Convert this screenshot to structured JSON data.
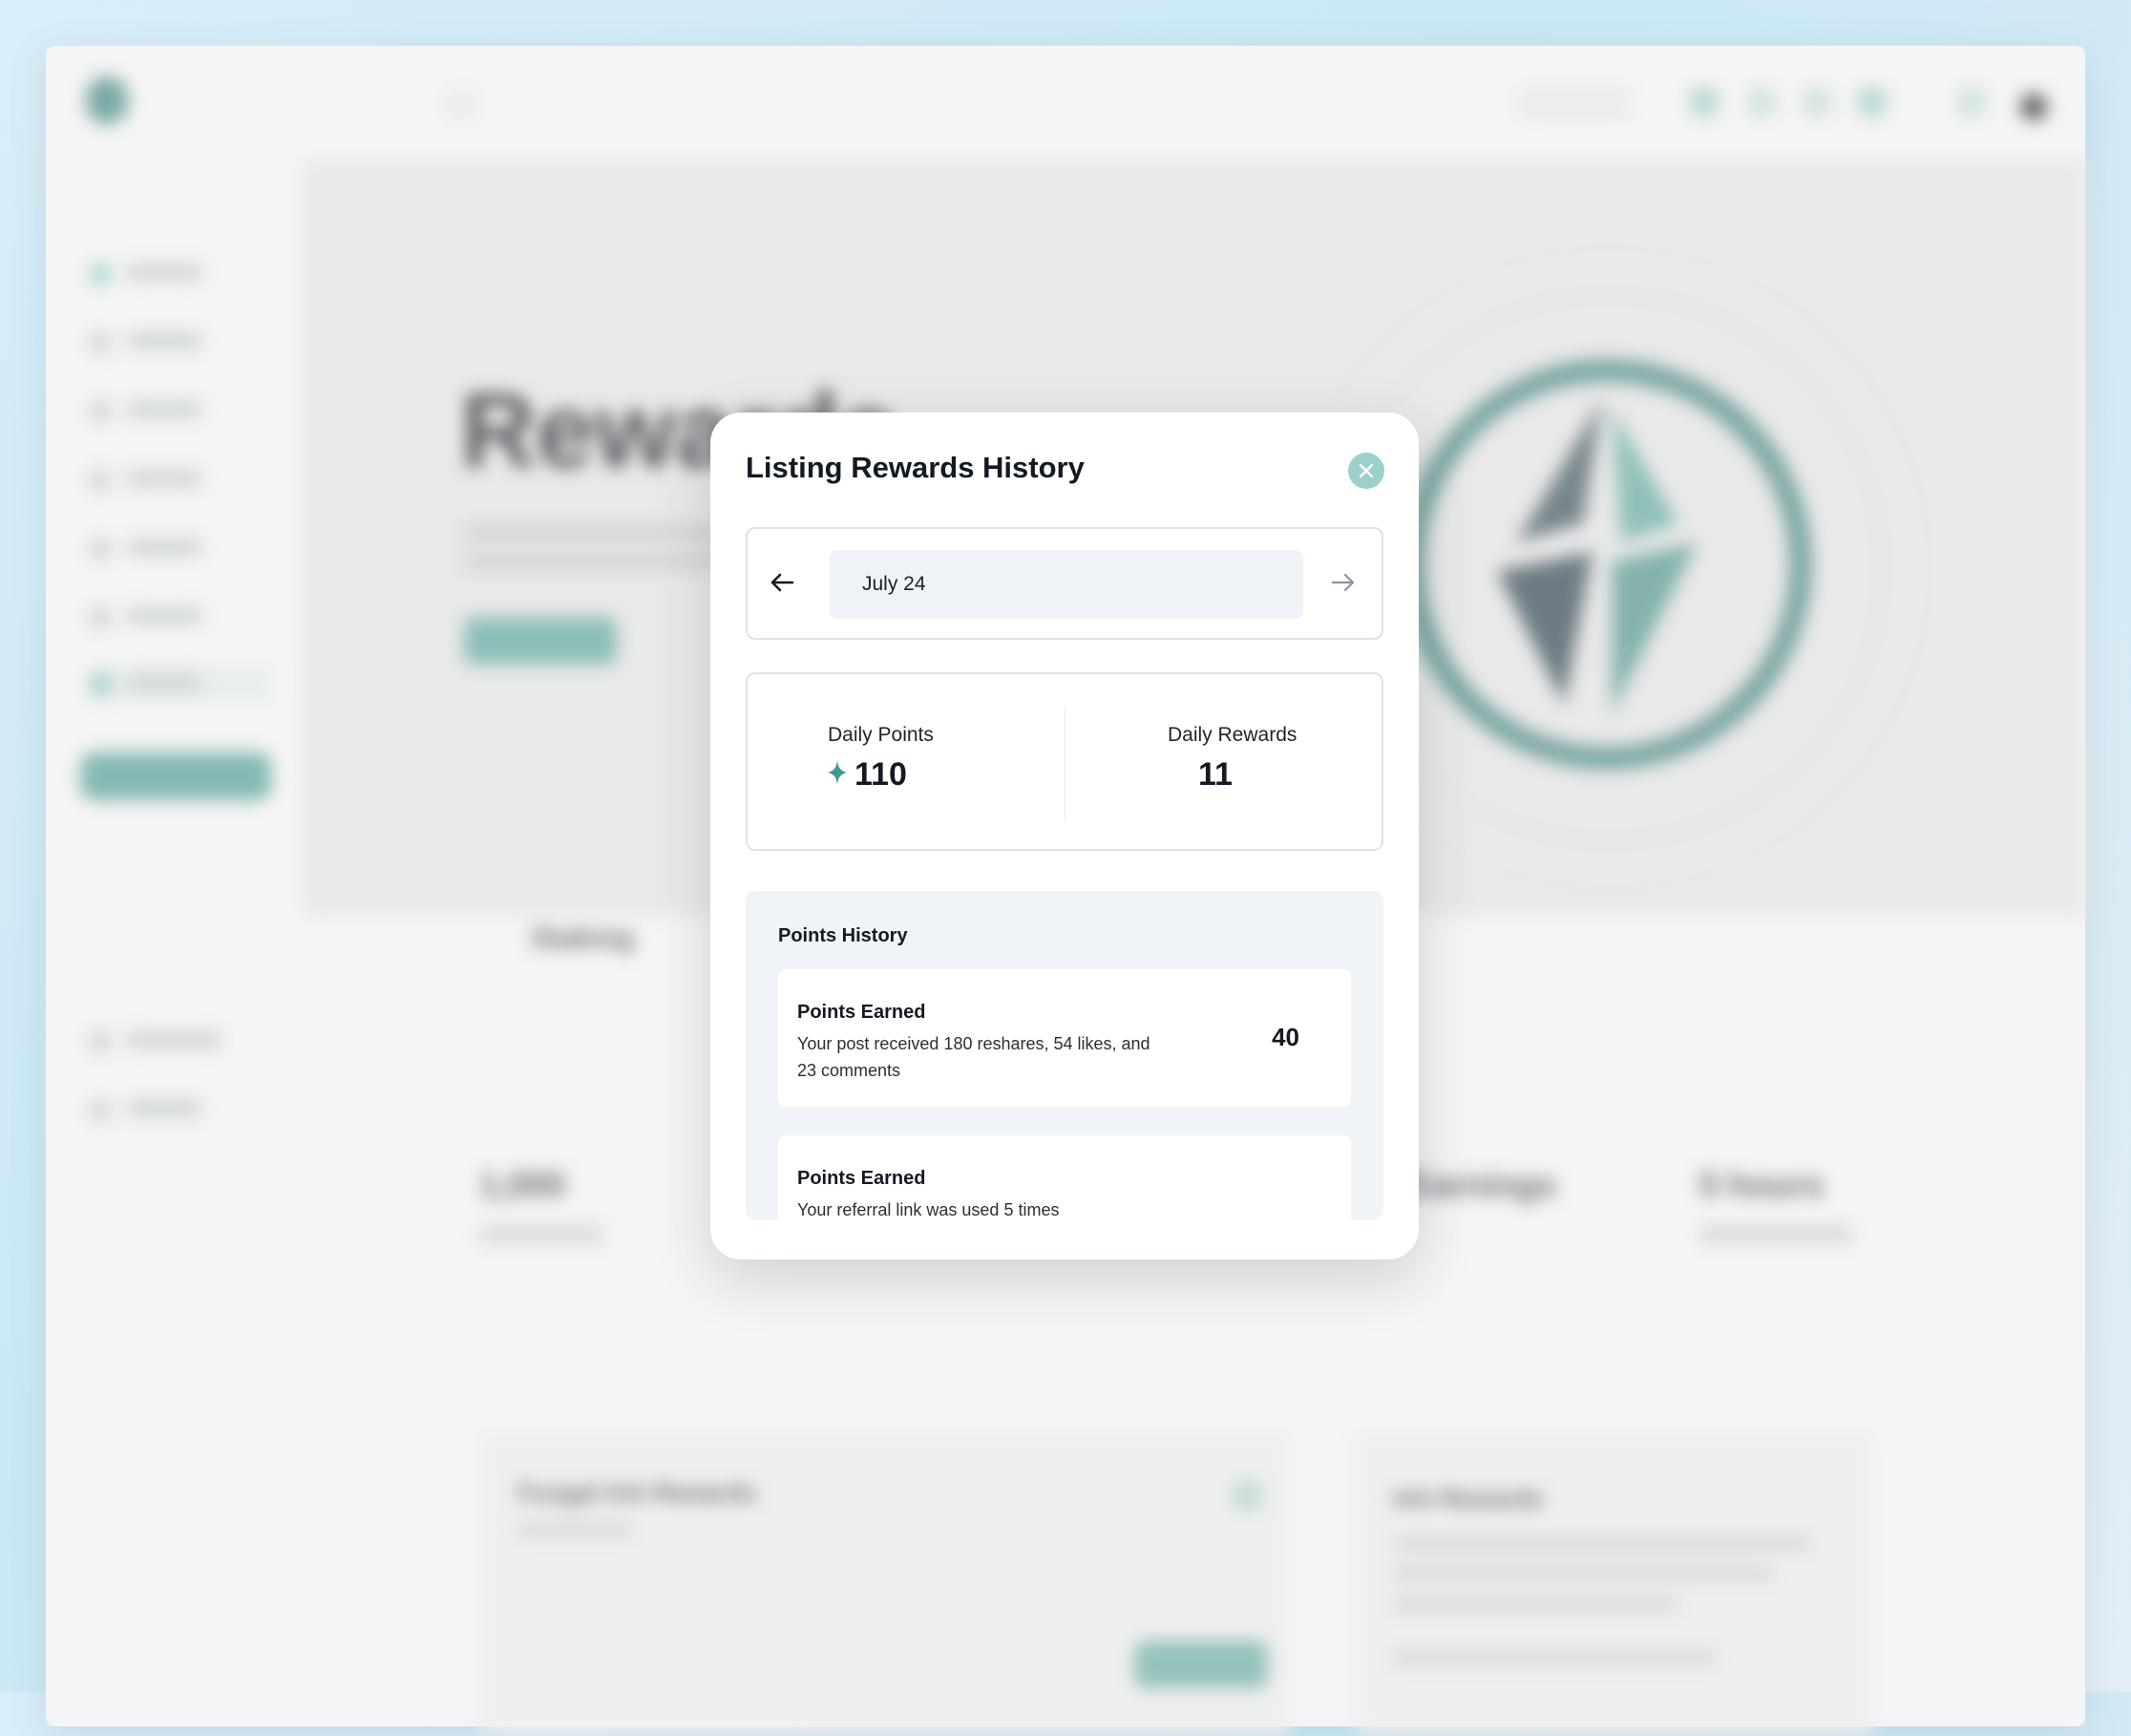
{
  "background": {
    "hero_title": "Rewards",
    "section_label": "Staking",
    "stat_1": "1,000",
    "stat_2": "Earnings",
    "stat_3": "5 hours",
    "card_title": "Fungal Ark Rewards",
    "card_right_title": "Ark Rewards"
  },
  "modal": {
    "title": "Listing Rewards History",
    "date": "July 24",
    "daily_points_label": "Daily Points",
    "daily_points_value": "110",
    "daily_rewards_label": "Daily Rewards",
    "daily_rewards_value": "11",
    "history_title": "Points History",
    "history": [
      {
        "title": "Points Earned",
        "description": "Your post received 180 reshares, 54 likes, and 23 comments",
        "points": "40"
      },
      {
        "title": "Points Earned",
        "description": "Your referral link was used 5 times",
        "points": ""
      }
    ]
  },
  "colors": {
    "accent": "#3d9a92",
    "close_bg": "#9cd0cc",
    "field_bg": "#eff2f6"
  },
  "icons": {
    "close": "close-icon",
    "prev": "arrow-left-icon",
    "next": "arrow-right-icon",
    "points": "sparkle-icon"
  }
}
